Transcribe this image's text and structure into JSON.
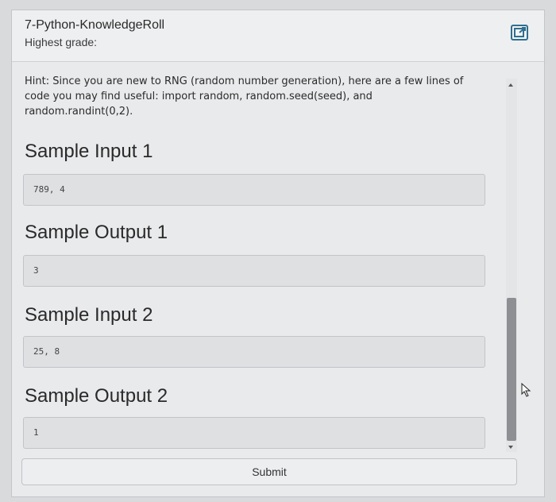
{
  "header": {
    "title": "7-Python-KnowledgeRoll",
    "subtitle": "Highest grade:",
    "expand_icon": "expand-square-icon"
  },
  "hint": {
    "text": "Hint: Since you are new to RNG (random number generation), here are a few lines of code you may find useful: import random, random.seed(seed), and random.randint(0,2)."
  },
  "samples": [
    {
      "heading": "Sample Input 1",
      "value": "789, 4"
    },
    {
      "heading": "Sample Output 1",
      "value": "3"
    },
    {
      "heading": "Sample Input 2",
      "value": "25, 8"
    },
    {
      "heading": "Sample Output 2",
      "value": "1"
    }
  ],
  "submit": {
    "label": "Submit"
  },
  "colors": {
    "panel_bg": "#e9eaec",
    "code_bg": "#dfe0e2",
    "accent": "#2f6f8f"
  }
}
